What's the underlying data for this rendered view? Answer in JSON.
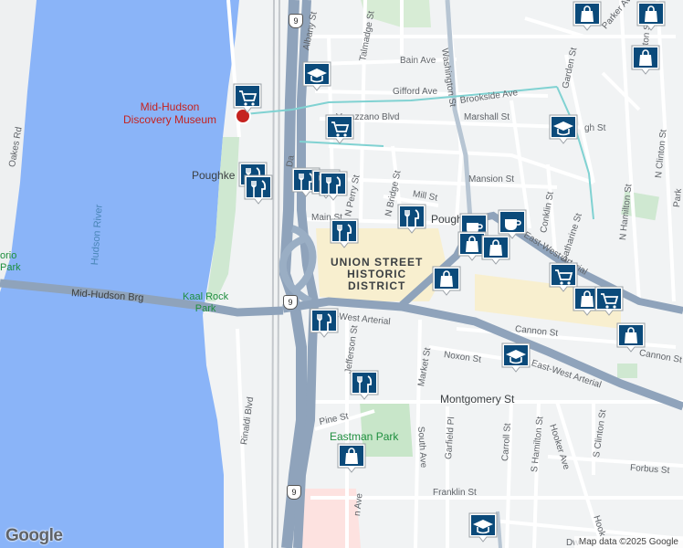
{
  "attribution": {
    "logo": "Google",
    "map_data": "Map data ©2025 Google"
  },
  "colors": {
    "water": "#8ab4f8",
    "land": "#f1f3f4",
    "park": "#c8e6c9",
    "highway": "#8fa3bb",
    "district": "#f8efcf",
    "pin": "#0b4a7a",
    "poi": "#c5221f"
  },
  "labels": {
    "district": "UNION STREET\nHISTORIC\nDISTRICT",
    "museum": "Mid-Hudson\nDiscovery Museum",
    "river": "Hudson River",
    "bridge": "Mid-Hudson Brg",
    "kaal_rock": "Kaal Rock\nPark",
    "eastman_park": "Eastman Park",
    "left_park": "orio\nPark",
    "poughkeepsie_station": "Poughke",
    "poughkeepsie_city": "Pough",
    "arterial_main": "East-West Arterial",
    "arterial_lower": "East-West Arterial",
    "arterial_right": "East-West Arterial",
    "streets": {
      "oakes": "Oakes Rd",
      "albany": "Albany St",
      "talmadge": "Talmadge St",
      "washington": "Washington St",
      "bain": "Bain Ave",
      "gifford": "Gifford Ave",
      "brookside": "Brookside Ave",
      "verazzano": "Verazzano Blvd",
      "marshall": "Marshall St",
      "garden": "Garden St",
      "parker": "Parker Ave",
      "hamilton": "Hamilton St",
      "clinton": "N Clinton St",
      "n_hamilton": "N Hamilton St",
      "burgh": "gh St",
      "mansion": "Mansion St",
      "mill": "Mill St",
      "main": "Main St",
      "n_perry": "N Perry St",
      "n_bridge": "N Bridge St",
      "conklin": "Conklin St",
      "catharine": "Catharine St",
      "cannon": "Cannon St",
      "cannon_right": "Cannon St",
      "noxon": "Noxon St",
      "jefferson": "Jefferson St",
      "market": "Market St",
      "rinaldi": "Rinaldi Blvd",
      "pine": "Pine St",
      "montgomery": "Montgomery St",
      "south_ave": "South Ave",
      "garfield": "Garfield Pl",
      "carroll": "Carroll St",
      "s_hamilton": "S Hamilton St",
      "hooker": "Hooker Ave",
      "s_clinton": "S Clinton St",
      "forbus": "Forbus St",
      "franklin": "Franklin St",
      "hooker_lower": "Hook",
      "dwight": "Dw",
      "park": "Park",
      "da": "Da",
      "on_ave": "n Ave"
    },
    "route_shield": "9"
  },
  "markers": [
    {
      "kind": "shopping-bag",
      "name": "shop"
    },
    {
      "kind": "shopping-bag",
      "name": "shop"
    },
    {
      "kind": "shopping-bag",
      "name": "shop"
    },
    {
      "kind": "school",
      "name": "school"
    },
    {
      "kind": "shopping-cart",
      "name": "grocery"
    },
    {
      "kind": "shopping-cart",
      "name": "grocery"
    },
    {
      "kind": "school",
      "name": "school"
    },
    {
      "kind": "restaurant",
      "name": "restaurant"
    },
    {
      "kind": "restaurant",
      "name": "restaurant"
    },
    {
      "kind": "restaurant",
      "name": "restaurant"
    },
    {
      "kind": "restaurant",
      "name": "restaurant"
    },
    {
      "kind": "restaurant",
      "name": "restaurant"
    },
    {
      "kind": "restaurant",
      "name": "restaurant"
    },
    {
      "kind": "cafe",
      "name": "cafe"
    },
    {
      "kind": "cafe",
      "name": "cafe"
    },
    {
      "kind": "shopping-bag",
      "name": "shop"
    },
    {
      "kind": "shopping-bag",
      "name": "shop"
    },
    {
      "kind": "restaurant",
      "name": "restaurant"
    },
    {
      "kind": "shopping-bag",
      "name": "shop"
    },
    {
      "kind": "shopping-cart",
      "name": "grocery"
    },
    {
      "kind": "shopping-bag",
      "name": "shop"
    },
    {
      "kind": "shopping-cart",
      "name": "grocery"
    },
    {
      "kind": "shopping-bag",
      "name": "shop"
    },
    {
      "kind": "restaurant",
      "name": "restaurant"
    },
    {
      "kind": "school",
      "name": "school"
    },
    {
      "kind": "restaurant",
      "name": "restaurant"
    },
    {
      "kind": "shopping-bag",
      "name": "shop"
    },
    {
      "kind": "school",
      "name": "school"
    }
  ]
}
